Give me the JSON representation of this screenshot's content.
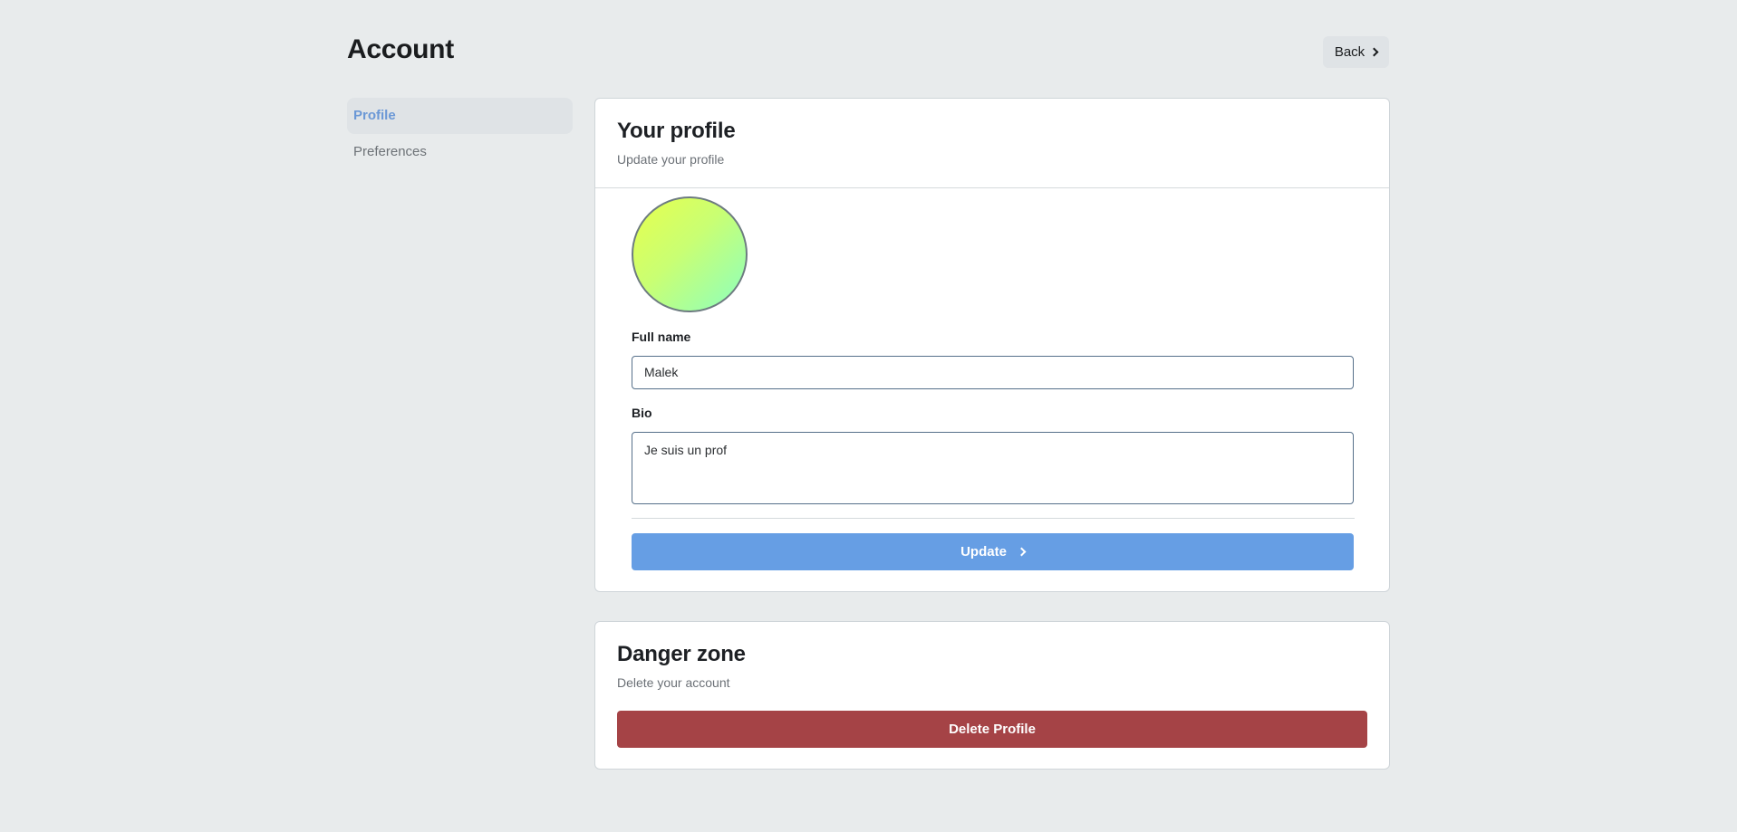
{
  "header": {
    "title": "Account",
    "back_label": "Back",
    "back_icon": "chevron-right-icon"
  },
  "sidebar": {
    "items": [
      {
        "label": "Profile",
        "active": true
      },
      {
        "label": "Preferences",
        "active": false
      }
    ]
  },
  "profile_card": {
    "title": "Your profile",
    "subtitle": "Update your profile",
    "avatar_gradient": [
      "#e7ff4d",
      "#8cffc0"
    ],
    "full_name_label": "Full name",
    "full_name_value": "Malek",
    "bio_label": "Bio",
    "bio_value": "Je suis un prof",
    "update_label": "Update",
    "update_icon": "chevron-right-icon"
  },
  "danger_card": {
    "title": "Danger zone",
    "subtitle": "Delete your account",
    "delete_label": "Delete Profile"
  },
  "colors": {
    "accent": "#669ee4",
    "danger": "#a54346",
    "background": "#e8ebec"
  }
}
